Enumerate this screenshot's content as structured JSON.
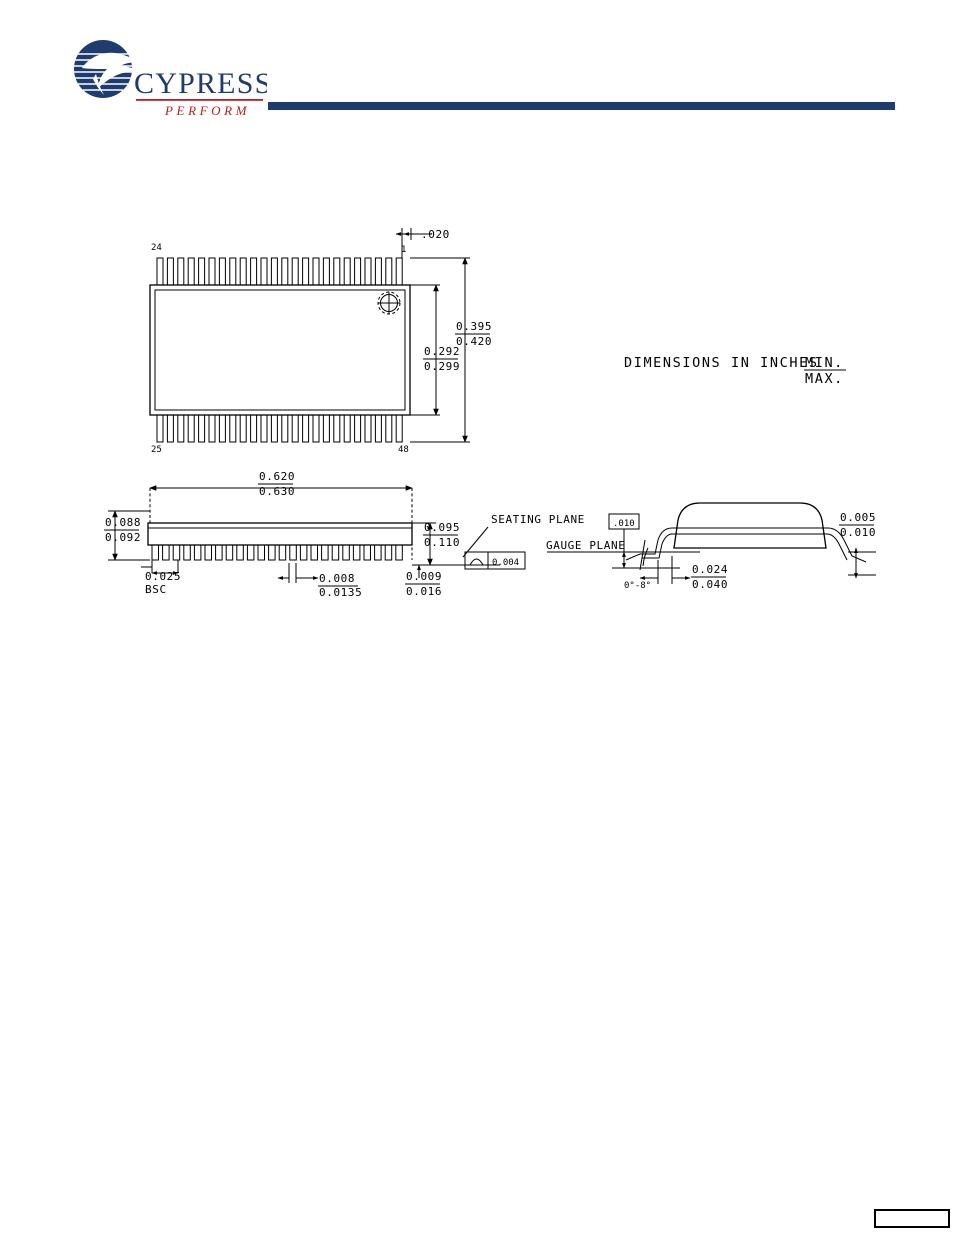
{
  "header": {
    "logo_name": "cypress-logo",
    "brand": "CYPRESS",
    "tagline": "PERFORM",
    "rule_color": "#1f3c6e"
  },
  "notes": {
    "dimensions_note_line1": "DIMENSIONS IN INCHES",
    "dimensions_note_min": "MIN.",
    "dimensions_note_max": "MAX."
  },
  "top_view": {
    "name": "top-view",
    "pin_top_left": "24",
    "pin_top_right": "1",
    "pin_bottom_left": "25",
    "pin_bottom_right": "48",
    "pin1_marker": "crosshair-target-icon",
    "lead_pitch_dim": ".020",
    "body_width_min": "0.292",
    "body_width_max": "0.299",
    "overall_width_min": "0.395",
    "overall_width_max": "0.420",
    "leads_per_side": 24
  },
  "side_view": {
    "name": "side-view",
    "body_length_min": "0.620",
    "body_length_max": "0.630",
    "standoff_min": "0.088",
    "standoff_max": "0.092",
    "pitch_value": "0.025",
    "pitch_label": "BSC",
    "lead_width_min": "0.008",
    "lead_width_max": "0.0135",
    "total_height_min": "0.095",
    "total_height_max": "0.110",
    "lead_thickness_min": "0.009",
    "lead_thickness_max": "0.016",
    "seating_plane_label": "SEATING PLANE",
    "flatness_symbol": "flatness-icon",
    "flatness_value": "0.004"
  },
  "detail_view": {
    "name": "lead-detail-view",
    "gauge_plane_label": "GAUGE PLANE",
    "gauge_plane_dim": ".010",
    "lead_angle": "0°-8°",
    "lead_foot_min": "0.024",
    "lead_foot_max": "0.040",
    "lead_tip_min": "0.005",
    "lead_tip_max": "0.010"
  },
  "footer": {
    "page_box_label": ""
  }
}
